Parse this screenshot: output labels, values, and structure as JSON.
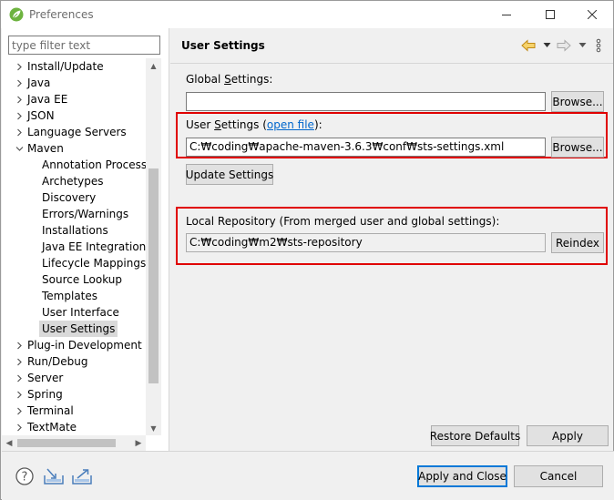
{
  "window": {
    "title": "Preferences"
  },
  "filter": {
    "placeholder": "type filter text"
  },
  "tree": {
    "items": [
      {
        "label": "Install/Update",
        "level": 0,
        "expanded": false
      },
      {
        "label": "Java",
        "level": 0,
        "expanded": false
      },
      {
        "label": "Java EE",
        "level": 0,
        "expanded": false
      },
      {
        "label": "JSON",
        "level": 0,
        "expanded": false
      },
      {
        "label": "Language Servers",
        "level": 0,
        "expanded": false
      },
      {
        "label": "Maven",
        "level": 0,
        "expanded": true
      },
      {
        "label": "Annotation Processin",
        "level": 1
      },
      {
        "label": "Archetypes",
        "level": 1
      },
      {
        "label": "Discovery",
        "level": 1
      },
      {
        "label": "Errors/Warnings",
        "level": 1
      },
      {
        "label": "Installations",
        "level": 1
      },
      {
        "label": "Java EE Integration",
        "level": 1
      },
      {
        "label": "Lifecycle Mappings",
        "level": 1
      },
      {
        "label": "Source Lookup",
        "level": 1
      },
      {
        "label": "Templates",
        "level": 1
      },
      {
        "label": "User Interface",
        "level": 1
      },
      {
        "label": "User Settings",
        "level": 1,
        "selected": true
      },
      {
        "label": "Plug-in Development",
        "level": 0,
        "expanded": false
      },
      {
        "label": "Run/Debug",
        "level": 0,
        "expanded": false
      },
      {
        "label": "Server",
        "level": 0,
        "expanded": false
      },
      {
        "label": "Spring",
        "level": 0,
        "expanded": false
      },
      {
        "label": "Terminal",
        "level": 0,
        "expanded": false
      },
      {
        "label": "TextMate",
        "level": 0,
        "expanded": false
      }
    ]
  },
  "page": {
    "title": "User Settings",
    "global_settings": {
      "label_pre": "Global ",
      "label_mnemonic": "S",
      "label_post": "ettings:",
      "value": "",
      "browse": "Browse..."
    },
    "user_settings": {
      "label_pre": "User ",
      "label_mnemonic": "S",
      "label_post": "ettings (",
      "link": "open file",
      "label_end": "):",
      "value": "C:₩coding₩apache-maven-3.6.3₩conf₩sts-settings.xml",
      "browse": "Browse..."
    },
    "update_settings": "Update Settings",
    "local_repository": {
      "label": "Local Repository (From merged user and global settings):",
      "value": "C:₩coding₩m2₩sts-repository",
      "reindex": "Reindex"
    },
    "restore_defaults": "Restore Defaults",
    "apply": "Apply"
  },
  "footer": {
    "apply_and_close": "Apply and Close",
    "cancel": "Cancel"
  },
  "colors": {
    "highlight": "#e00000",
    "link": "#0066cc",
    "default_button_border": "#0078d7"
  }
}
